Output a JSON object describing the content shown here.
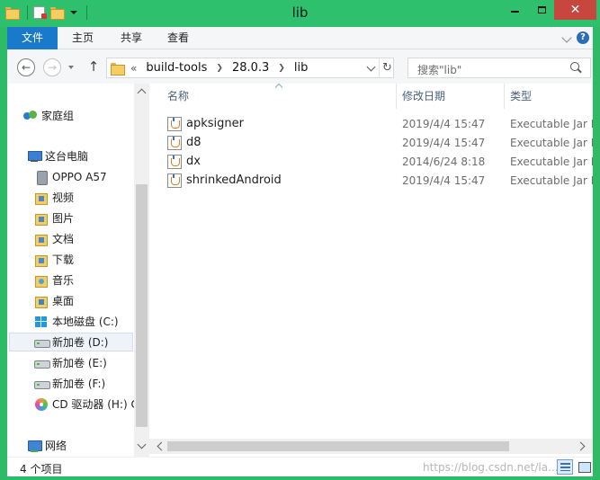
{
  "window": {
    "title": "lib"
  },
  "ribbon": {
    "tabs": [
      {
        "label": "文件",
        "active": true
      },
      {
        "label": "主页"
      },
      {
        "label": "共享"
      },
      {
        "label": "查看"
      }
    ],
    "help_glyph": "?"
  },
  "address": {
    "lead": "«",
    "crumbs": [
      "build-tools",
      "28.0.3",
      "lib"
    ]
  },
  "search": {
    "placeholder": "搜索\"lib\""
  },
  "nav": {
    "items": [
      {
        "label": "家庭组",
        "icon": "homegroup-icon"
      },
      {
        "label": "这台电脑",
        "icon": "pc-icon"
      },
      {
        "label": "OPPO A57",
        "icon": "phone-icon"
      },
      {
        "label": "视频",
        "icon": "videos-folder-icon"
      },
      {
        "label": "图片",
        "icon": "pictures-folder-icon"
      },
      {
        "label": "文档",
        "icon": "documents-folder-icon"
      },
      {
        "label": "下载",
        "icon": "downloads-folder-icon"
      },
      {
        "label": "音乐",
        "icon": "music-folder-icon"
      },
      {
        "label": "桌面",
        "icon": "desktop-folder-icon"
      },
      {
        "label": "本地磁盘 (C:)",
        "icon": "windows-drive-icon"
      },
      {
        "label": "新加卷 (D:)",
        "icon": "drive-icon",
        "selected": true
      },
      {
        "label": "新加卷 (E:)",
        "icon": "drive-icon"
      },
      {
        "label": "新加卷 (F:)",
        "icon": "drive-icon"
      },
      {
        "label": "CD 驱动器 (H:) C",
        "icon": "cd-drive-icon"
      },
      {
        "label": "网络",
        "icon": "network-icon"
      }
    ]
  },
  "columns": {
    "name": "名称",
    "date": "修改日期",
    "type": "类型"
  },
  "files": [
    {
      "name": "apksigner",
      "date": "2019/4/4 15:47",
      "type": "Executable Jar File"
    },
    {
      "name": "d8",
      "date": "2019/4/4 15:47",
      "type": "Executable Jar File"
    },
    {
      "name": "dx",
      "date": "2014/6/24 8:18",
      "type": "Executable Jar File"
    },
    {
      "name": "shrinkedAndroid",
      "date": "2019/4/4 15:47",
      "type": "Executable Jar File"
    }
  ],
  "status": {
    "count": "4 个项目",
    "watermark": "https://blog.csdn.net/la..."
  },
  "colors": {
    "titlebar": "#2fc06d",
    "file_tab": "#1979ca",
    "close_button": "#c7463e"
  }
}
